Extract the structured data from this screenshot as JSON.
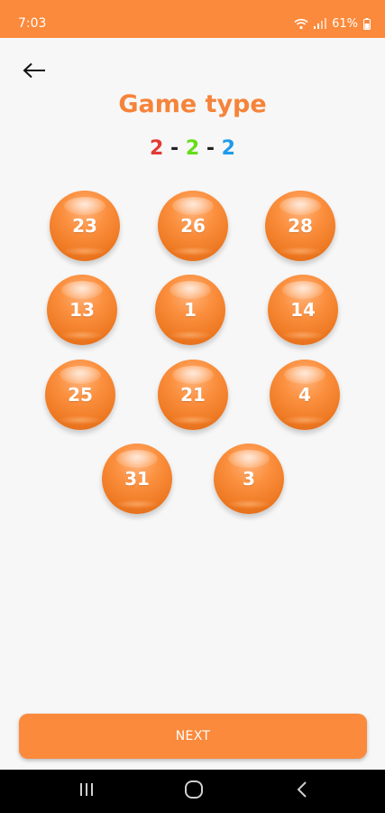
{
  "status_bar": {
    "time": "7:03",
    "battery": "61%",
    "icons": [
      "wifi-icon",
      "signal-icon",
      "battery-icon"
    ]
  },
  "header": {
    "back_icon": "arrow-left-icon",
    "title": "Game type"
  },
  "pattern": {
    "parts": [
      {
        "value": "2",
        "color": "#e53935"
      },
      {
        "value": "-",
        "color": "#222222"
      },
      {
        "value": "2",
        "color": "#64dd17"
      },
      {
        "value": "-",
        "color": "#222222"
      },
      {
        "value": "2",
        "color": "#1e9be9"
      }
    ]
  },
  "balls": [
    "23",
    "26",
    "28",
    "13",
    "1",
    "14",
    "25",
    "21",
    "4",
    "31",
    "3"
  ],
  "footer": {
    "next_label": "NEXT"
  },
  "nav_bar": {
    "icons": [
      "recents-icon",
      "home-icon",
      "back-icon"
    ]
  },
  "colors": {
    "accent": "#fb8a3c",
    "title": "#f5843a",
    "background": "#f7f7f7"
  }
}
